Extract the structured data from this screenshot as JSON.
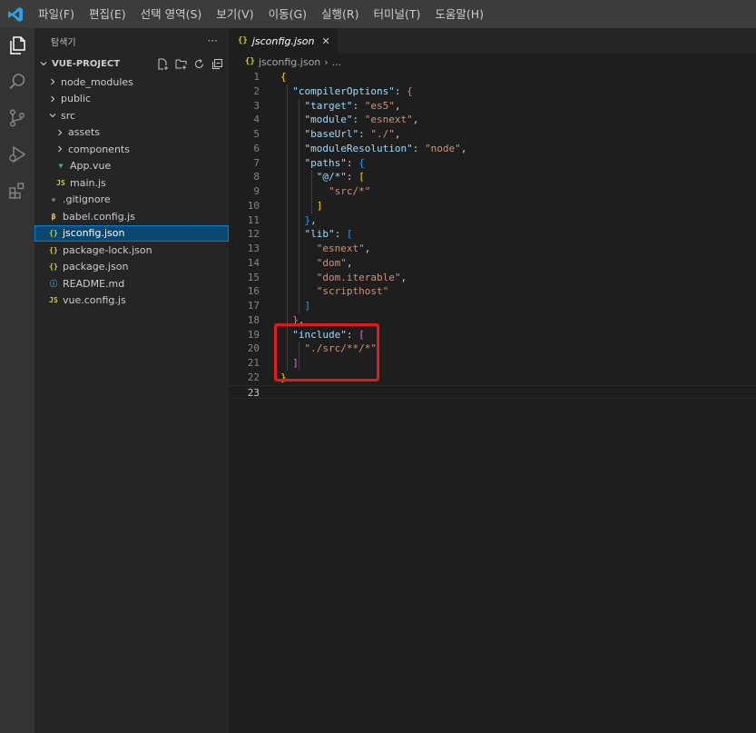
{
  "menu": [
    "파일(F)",
    "편집(E)",
    "선택 영역(S)",
    "보기(V)",
    "이동(G)",
    "실행(R)",
    "터미널(T)",
    "도움말(H)"
  ],
  "colors": {
    "menubar": "#3c3c3c",
    "activitybar": "#333333",
    "sidebar": "#252526",
    "editor": "#1e1e1e",
    "selection": "#094771",
    "highlight_box": "#e01b1b",
    "logo": "#2e9ee8"
  },
  "activity_icons": [
    "explorer-icon",
    "search-icon",
    "source-control-icon",
    "run-debug-icon",
    "extensions-icon"
  ],
  "sidebar": {
    "title": "탐색기",
    "more": "···",
    "project": "VUE-PROJECT",
    "tree": [
      {
        "label": "node_modules",
        "type": "folder",
        "expanded": false,
        "indent": 1
      },
      {
        "label": "public",
        "type": "folder",
        "expanded": false,
        "indent": 1
      },
      {
        "label": "src",
        "type": "folder",
        "expanded": true,
        "indent": 1
      },
      {
        "label": "assets",
        "type": "folder",
        "expanded": false,
        "indent": 2
      },
      {
        "label": "components",
        "type": "folder",
        "expanded": false,
        "indent": 2
      },
      {
        "label": "App.vue",
        "type": "vue",
        "indent": 2
      },
      {
        "label": "main.js",
        "type": "js",
        "indent": 2
      },
      {
        "label": ".gitignore",
        "type": "git",
        "indent": 1
      },
      {
        "label": "babel.config.js",
        "type": "babel",
        "indent": 1
      },
      {
        "label": "jsconfig.json",
        "type": "json",
        "indent": 1,
        "selected": true
      },
      {
        "label": "package-lock.json",
        "type": "json",
        "indent": 1
      },
      {
        "label": "package.json",
        "type": "json",
        "indent": 1
      },
      {
        "label": "README.md",
        "type": "info",
        "indent": 1
      },
      {
        "label": "vue.config.js",
        "type": "js",
        "indent": 1
      }
    ]
  },
  "editor": {
    "tab_icon": "{}",
    "tab_label": "jsconfig.json",
    "tab_close": "✕",
    "breadcrumb_icon": "{}",
    "breadcrumb_file": "jsconfig.json",
    "breadcrumb_sep": "›",
    "breadcrumb_more": "...",
    "current_line": 23,
    "lines": [
      [
        [
          "{",
          "b1"
        ]
      ],
      [
        [
          "  ",
          ""
        ],
        [
          "\"compilerOptions\"",
          "k"
        ],
        [
          ": ",
          "p"
        ],
        [
          "{",
          "b2"
        ]
      ],
      [
        [
          "    ",
          ""
        ],
        [
          "\"target\"",
          "k"
        ],
        [
          ": ",
          "p"
        ],
        [
          "\"es5\"",
          "s"
        ],
        [
          ",",
          "p"
        ]
      ],
      [
        [
          "    ",
          ""
        ],
        [
          "\"module\"",
          "k"
        ],
        [
          ": ",
          "p"
        ],
        [
          "\"esnext\"",
          "s"
        ],
        [
          ",",
          "p"
        ]
      ],
      [
        [
          "    ",
          ""
        ],
        [
          "\"baseUrl\"",
          "k"
        ],
        [
          ": ",
          "p"
        ],
        [
          "\"./\"",
          "s"
        ],
        [
          ",",
          "p"
        ]
      ],
      [
        [
          "    ",
          ""
        ],
        [
          "\"moduleResolution\"",
          "k"
        ],
        [
          ": ",
          "p"
        ],
        [
          "\"node\"",
          "s"
        ],
        [
          ",",
          "p"
        ]
      ],
      [
        [
          "    ",
          ""
        ],
        [
          "\"paths\"",
          "k"
        ],
        [
          ": ",
          "p"
        ],
        [
          "{",
          "b3"
        ]
      ],
      [
        [
          "      ",
          ""
        ],
        [
          "\"@/*\"",
          "k"
        ],
        [
          ": ",
          "p"
        ],
        [
          "[",
          "b1"
        ]
      ],
      [
        [
          "        ",
          ""
        ],
        [
          "\"src/*\"",
          "s"
        ]
      ],
      [
        [
          "      ",
          ""
        ],
        [
          "]",
          "b1"
        ]
      ],
      [
        [
          "    ",
          ""
        ],
        [
          "}",
          "b3"
        ],
        [
          ",",
          "p"
        ]
      ],
      [
        [
          "    ",
          ""
        ],
        [
          "\"lib\"",
          "k"
        ],
        [
          ": ",
          "p"
        ],
        [
          "[",
          "b3"
        ]
      ],
      [
        [
          "      ",
          ""
        ],
        [
          "\"esnext\"",
          "s"
        ],
        [
          ",",
          "p"
        ]
      ],
      [
        [
          "      ",
          ""
        ],
        [
          "\"dom\"",
          "s"
        ],
        [
          ",",
          "p"
        ]
      ],
      [
        [
          "      ",
          ""
        ],
        [
          "\"dom.iterable\"",
          "s"
        ],
        [
          ",",
          "p"
        ]
      ],
      [
        [
          "      ",
          ""
        ],
        [
          "\"scripthost\"",
          "s"
        ]
      ],
      [
        [
          "    ",
          ""
        ],
        [
          "]",
          "b3"
        ]
      ],
      [
        [
          "  ",
          ""
        ],
        [
          "}",
          "b2"
        ],
        [
          ",",
          "p"
        ]
      ],
      [
        [
          "  ",
          ""
        ],
        [
          "\"include\"",
          "k"
        ],
        [
          ": ",
          "p"
        ],
        [
          "[",
          "b2"
        ]
      ],
      [
        [
          "    ",
          ""
        ],
        [
          "\"./src/**/*\"",
          "s"
        ]
      ],
      [
        [
          "  ",
          ""
        ],
        [
          "]",
          "b2"
        ]
      ],
      [
        [
          "}",
          "b1"
        ]
      ],
      []
    ]
  }
}
